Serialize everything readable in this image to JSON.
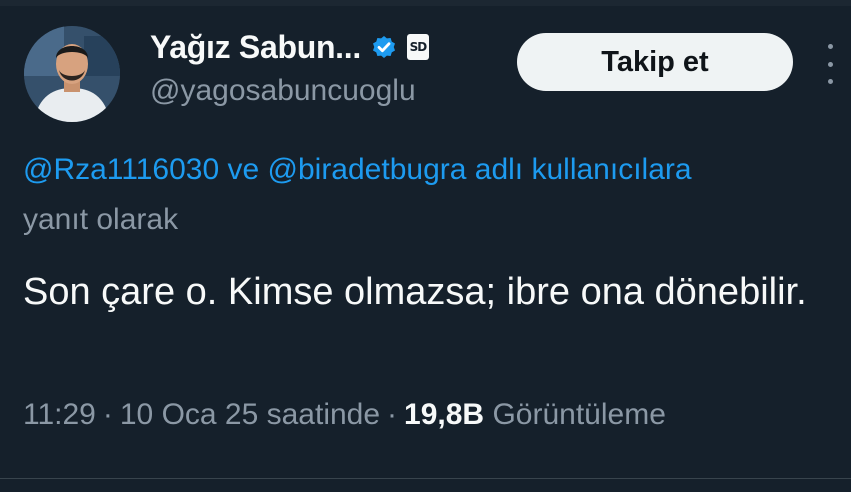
{
  "author": {
    "display_name": "Yağız Sabun...",
    "handle": "@yagosabuncuoglu",
    "verified_icon": "verified-badge-icon",
    "affiliate_badge": "SD"
  },
  "actions": {
    "follow_label": "Takip et",
    "more_icon": "more-options-icon"
  },
  "reply_context": {
    "mention_1": "@Rza1116030",
    "connector": " ve ",
    "mention_2": "@biradetbugra",
    "suffix_inline": " adlı kullanıcılara",
    "suffix_line2": "yanıt olarak"
  },
  "tweet": {
    "text": "Son çare o. Kimse olmazsa; ibre ona dönebilir.",
    "time": "11:29",
    "separator": "·",
    "date": "10 Oca 25 saatinde",
    "views_count": "19,8B",
    "views_label": "Görüntüleme"
  },
  "colors": {
    "background": "#15202b",
    "link": "#1d9bf0",
    "secondary_text": "#8b98a5",
    "primary_text": "#f7f9f9",
    "button_bg": "#eff3f4"
  }
}
